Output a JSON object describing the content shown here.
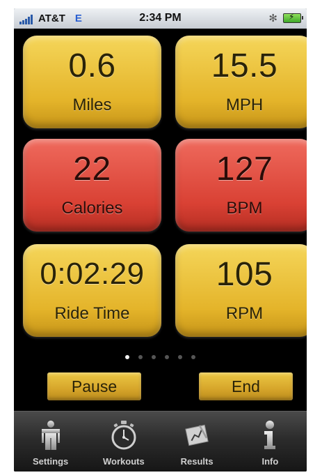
{
  "status": {
    "carrier": "AT&T",
    "network": "E",
    "time": "2:34 PM"
  },
  "tiles": [
    {
      "value": "0.6",
      "label": "Miles",
      "color": "#e8bb32"
    },
    {
      "value": "15.5",
      "label": "MPH",
      "color": "#e8bb32"
    },
    {
      "value": "22",
      "label": "Calories",
      "color": "#dc4638"
    },
    {
      "value": "127",
      "label": "BPM",
      "color": "#dc4638"
    },
    {
      "value": "0:02:29",
      "label": "Ride Time",
      "color": "#e8bb32"
    },
    {
      "value": "105",
      "label": "RPM",
      "color": "#e8bb32"
    }
  ],
  "pager": {
    "pages": 6,
    "current": 1
  },
  "buttons": {
    "pause": "Pause",
    "end": "End"
  },
  "tabs": [
    {
      "label": "Settings",
      "icon": "person-icon"
    },
    {
      "label": "Workouts",
      "icon": "stopwatch-icon"
    },
    {
      "label": "Results",
      "icon": "clipboard-icon"
    },
    {
      "label": "Info",
      "icon": "info-icon"
    }
  ]
}
